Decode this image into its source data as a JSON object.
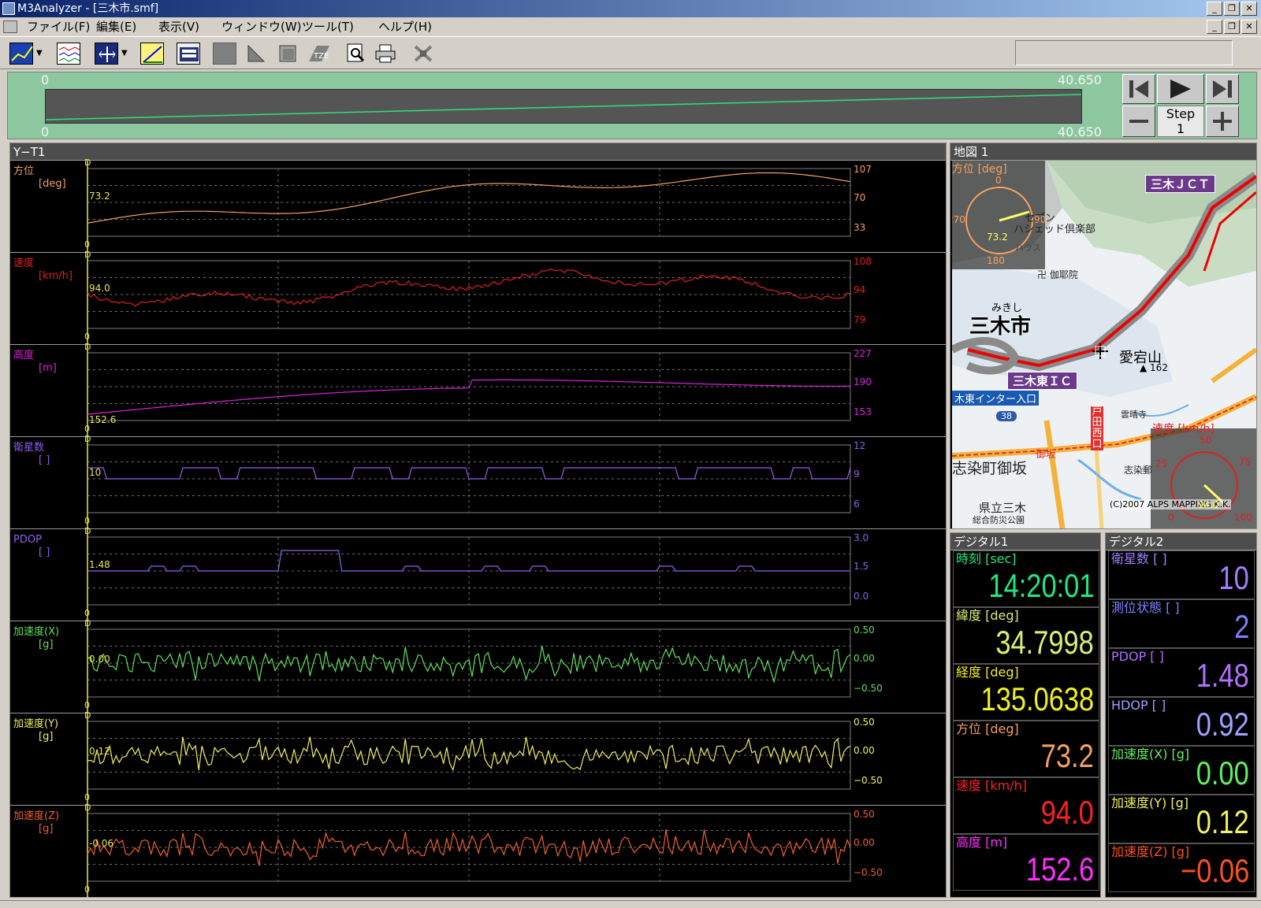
{
  "window": {
    "title": "M3Analyzer - [三木市.smf]"
  },
  "menu": [
    "ファイル(F)",
    "編集(E)",
    "表示(V)",
    "ウィンドウ(W)",
    "ツール(T)",
    "ヘルプ(H)"
  ],
  "toolbar": {
    "icons": [
      "yt-graph-icon",
      "yt-dropdown-icon",
      "multi-graph-icon",
      "xy-graph-icon",
      "xy-dropdown-icon",
      "measure-icon",
      "digital-icon",
      "square-icon",
      "triangle-icon",
      "frame-icon",
      "tze-icon",
      "preview-icon",
      "print-icon",
      "satellite-icon"
    ]
  },
  "timeline": {
    "start_top": "0",
    "end_top": "40.650",
    "start_bottom": "0",
    "end_bottom": "40.650",
    "step_label": "Step",
    "step_value": "1"
  },
  "yt_panel": {
    "title": "Y−T1",
    "charts": [
      {
        "name": "方位",
        "unit": "[deg]",
        "color": "#f5a060",
        "current": "73.2",
        "axis": [
          "107",
          "70",
          "33"
        ],
        "zero": "0",
        "d": "D"
      },
      {
        "name": "速度",
        "unit": "[km/h]",
        "color": "#e02020",
        "current": "94.0",
        "axis": [
          "108",
          "94",
          "79"
        ],
        "zero": "0",
        "d": "D"
      },
      {
        "name": "高度",
        "unit": "[m]",
        "color": "#e020e0",
        "current": "152.6",
        "axis": [
          "227",
          "190",
          "153"
        ],
        "zero": "0",
        "d": "D"
      },
      {
        "name": "衛星数",
        "unit": "[ ]",
        "color": "#9060f0",
        "current": "10",
        "axis": [
          "12",
          "9",
          "6"
        ],
        "zero": "0",
        "d": "D"
      },
      {
        "name": "PDOP",
        "unit": "[ ]",
        "color": "#9060f0",
        "current": "1.48",
        "axis": [
          "3.0",
          "1.5",
          "0.0"
        ],
        "zero": "0",
        "d": "D"
      },
      {
        "name": "加速度(X)",
        "unit": "[g]",
        "color": "#60e060",
        "current": "0.00",
        "axis": [
          "0.50",
          "0.00",
          "−0.50"
        ],
        "zero": "0",
        "d": "D"
      },
      {
        "name": "加速度(Y)",
        "unit": "[g]",
        "color": "#f0f060",
        "current": "0.12",
        "axis": [
          "0.50",
          "0.00",
          "−0.50"
        ],
        "zero": "0",
        "d": "D"
      },
      {
        "name": "加速度(Z)",
        "unit": "[g]",
        "color": "#f06030",
        "current": "-0.06",
        "axis": [
          "0.50",
          "0.00",
          "−0.50"
        ],
        "zero": "0",
        "d": "D"
      }
    ]
  },
  "map_panel": {
    "title": "地図 1",
    "heading_gauge": {
      "label": "方位 [deg]",
      "n": "0",
      "e": "90",
      "s": "180",
      "w": "270",
      "value": "73.2"
    },
    "speed_gauge": {
      "label": "速度 [km/h]",
      "t50": "50",
      "t75": "75",
      "t25": "25",
      "t0": "0",
      "t100": "100",
      "value": "94.0"
    },
    "labels": {
      "jct": "三木ＪＣＴ",
      "ic": "三木東ＩＣ",
      "city_kana": "みきし",
      "city": "三木市",
      "mountain": "愛宕山",
      "mountain_height": "▲ 162",
      "inter_entrance": "木東インター入口",
      "route": "38",
      "toda": "戸田西口",
      "misaka": "御坂",
      "town": "志染町御坂",
      "school": "県立三木",
      "school2": "総合防災公園",
      "temple": "卍 伽耶院",
      "temple2": "雲晴寺",
      "shizome": "志染郵",
      "seven": "セブン",
      "club": "ハシェッド倶楽部",
      "house": "ハウス",
      "copyright": "(C)2007 ALPS MAPPING K.K."
    }
  },
  "digital1": {
    "title": "デジタル1",
    "cells": [
      {
        "label": "時刻 [sec]",
        "value": "14:20:01",
        "color": "#20e880"
      },
      {
        "label": "緯度 [deg]",
        "value": "34.7998",
        "color": "#d8f070"
      },
      {
        "label": "経度 [deg]",
        "value": "135.0638",
        "color": "#f0f020"
      },
      {
        "label": "方位 [deg]",
        "value": "73.2",
        "color": "#f5a060"
      },
      {
        "label": "速度 [km/h]",
        "value": "94.0",
        "color": "#ff2020"
      },
      {
        "label": "高度 [m]",
        "value": "152.6",
        "color": "#ff30ff"
      }
    ]
  },
  "digital2": {
    "title": "デジタル2",
    "cells": [
      {
        "label": "衛星数 [ ]",
        "value": "10",
        "color": "#a080ff"
      },
      {
        "label": "測位状態 [ ]",
        "value": "2",
        "color": "#8080ff"
      },
      {
        "label": "PDOP [ ]",
        "value": "1.48",
        "color": "#b070ff"
      },
      {
        "label": "HDOP [ ]",
        "value": "0.92",
        "color": "#a0a0ff"
      },
      {
        "label": "加速度(X) [g]",
        "value": "0.00",
        "color": "#60f060"
      },
      {
        "label": "加速度(Y) [g]",
        "value": "0.12",
        "color": "#f0f060"
      },
      {
        "label": "加速度(Z) [g]",
        "value": "−0.06",
        "color": "#ff5020"
      }
    ]
  }
}
